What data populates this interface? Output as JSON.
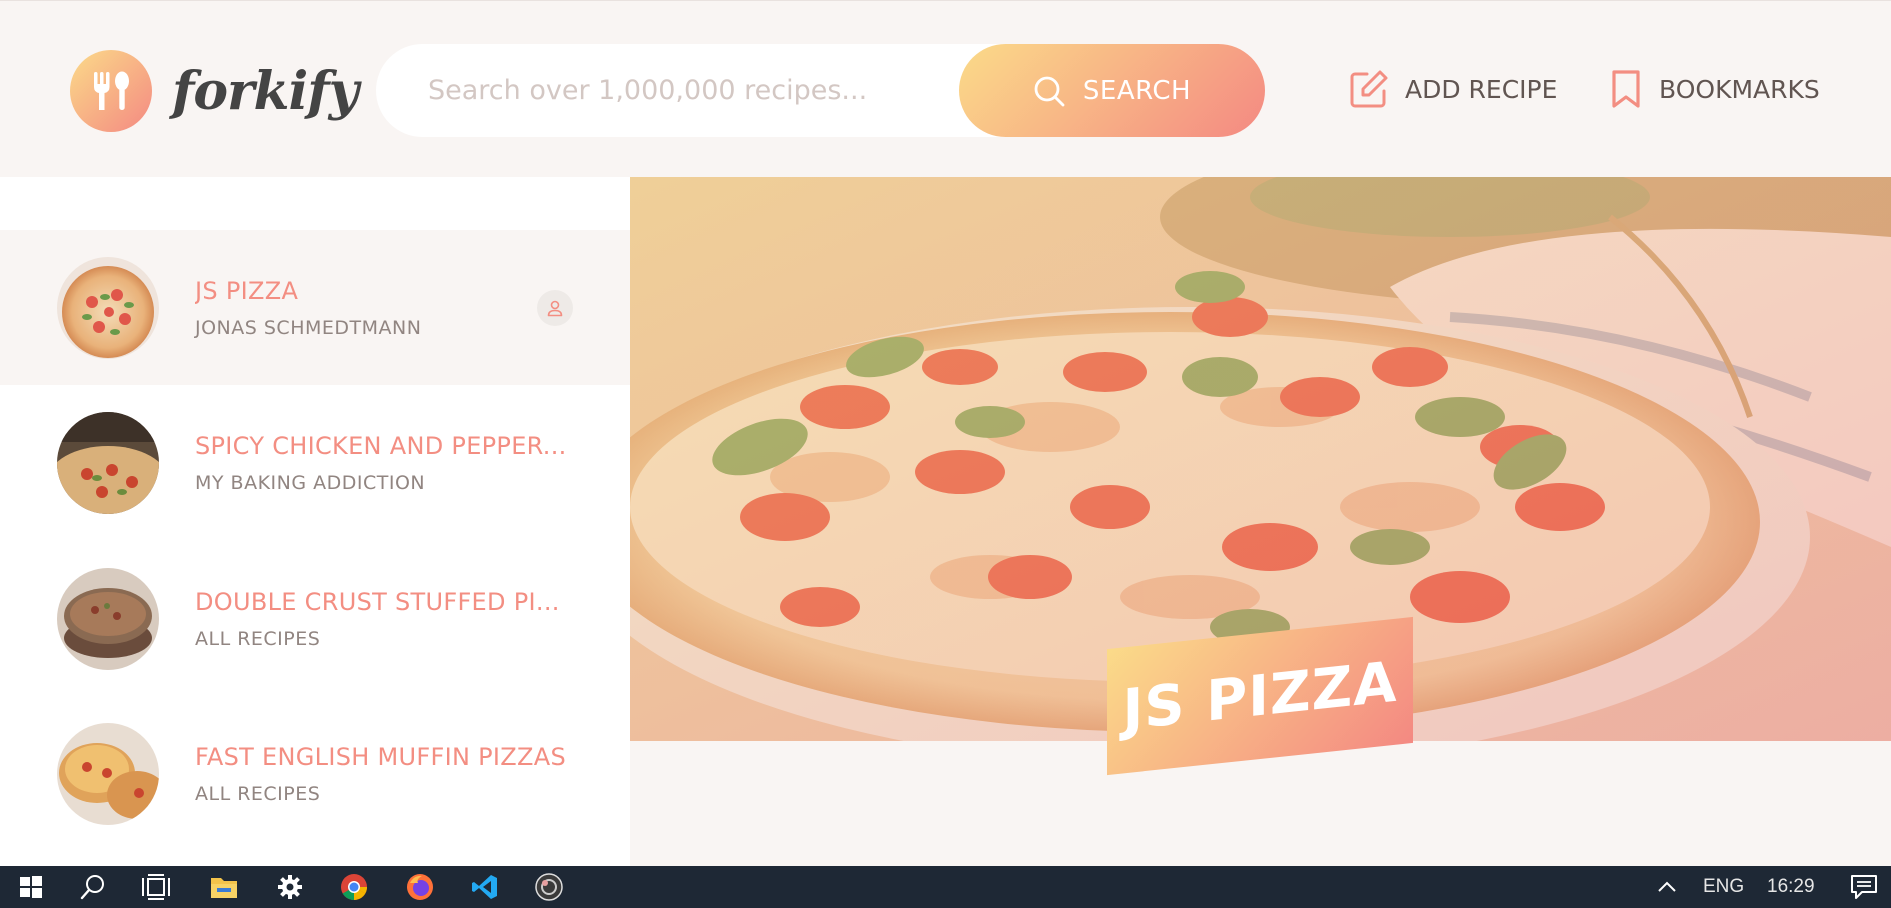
{
  "header": {
    "logo_text": "forkify",
    "search_placeholder": "Search over 1,000,000 recipes...",
    "search_button_label": "SEARCH",
    "nav": {
      "add_recipe_label": "ADD RECIPE",
      "bookmarks_label": "BOOKMARKS"
    }
  },
  "results": [
    {
      "title": "JS PIZZA",
      "publisher": "JONAS SCHMEDTMANN",
      "active": true,
      "user_generated": true
    },
    {
      "title": "SPICY CHICKEN AND PEPPER...",
      "publisher": "MY BAKING ADDICTION",
      "active": false,
      "user_generated": false
    },
    {
      "title": "DOUBLE CRUST STUFFED PI...",
      "publisher": "ALL RECIPES",
      "active": false,
      "user_generated": false
    },
    {
      "title": "FAST ENGLISH MUFFIN PIZZAS",
      "publisher": "ALL RECIPES",
      "active": false,
      "user_generated": false
    }
  ],
  "recipe": {
    "title": "JS PIZZA"
  },
  "taskbar": {
    "apps": [
      "start-icon",
      "search-icon",
      "task-view-icon",
      "file-explorer-icon",
      "settings-icon",
      "chrome-icon",
      "firefox-icon",
      "vscode-icon",
      "obs-icon"
    ],
    "language": "ENG",
    "time": "16:29"
  },
  "colors": {
    "accent_start": "#fbdb89",
    "accent_end": "#f48982",
    "title_color": "#f38e82",
    "text_color": "#615551",
    "taskbar_bg": "#1e2835"
  }
}
